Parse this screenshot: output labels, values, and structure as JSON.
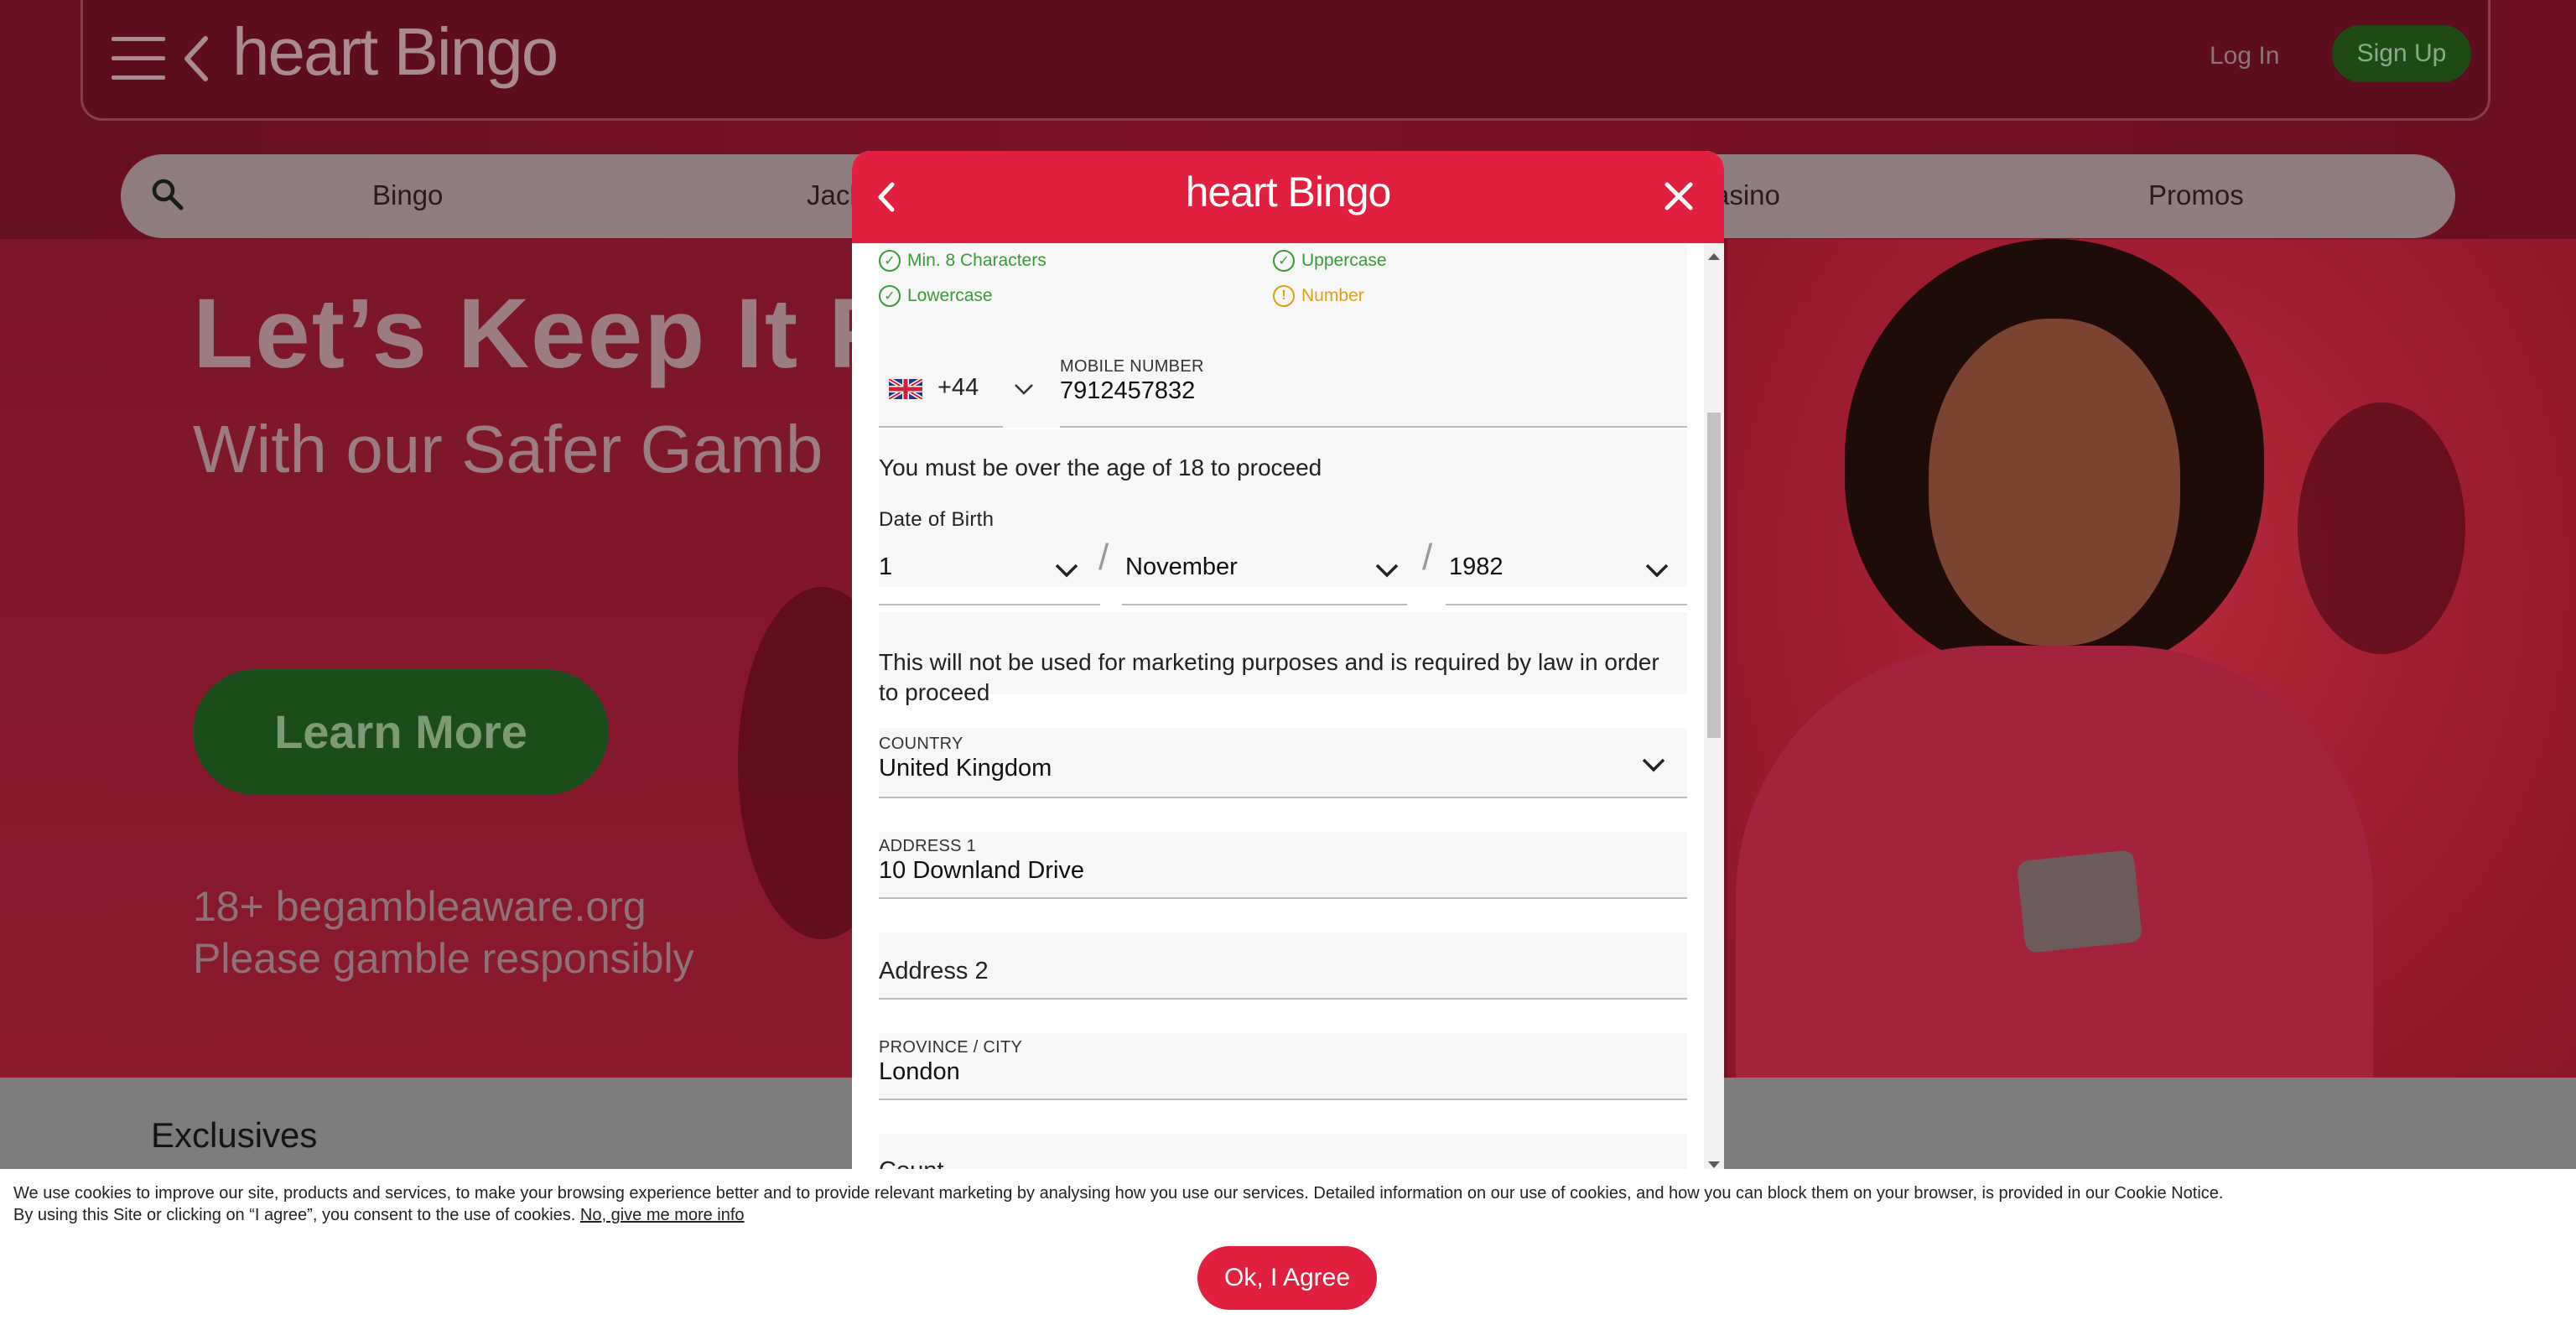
{
  "header": {
    "logo": "heart Bingo",
    "login_label": "Log In",
    "signup_label": "Sign Up"
  },
  "nav": {
    "items": [
      "Bingo",
      "Jack",
      "asino",
      "Promos"
    ]
  },
  "hero": {
    "title": "Let’s Keep It F",
    "subtitle": "With our Safer Gamb",
    "cta_label": "Learn More",
    "responsible_1": "18+ begambleaware.org",
    "responsible_2": "Please gamble responsibly"
  },
  "exclusives": {
    "title": "Exclusives"
  },
  "modal": {
    "logo": "heart Bingo",
    "password_rules": [
      {
        "label": "Min. 8 Characters",
        "status": "ok"
      },
      {
        "label": "Uppercase",
        "status": "ok"
      },
      {
        "label": "Lowercase",
        "status": "ok"
      },
      {
        "label": "Number",
        "status": "warning"
      }
    ],
    "phone": {
      "country_code": "+44",
      "label": "MOBILE NUMBER",
      "value": "7912457832"
    },
    "age_notice": "You must be over the age of 18 to proceed",
    "dob": {
      "label": "Date of Birth",
      "day": "1",
      "month": "November",
      "year": "1982",
      "separator": "/"
    },
    "dob_notice": "This will not be used for marketing purposes and is required by law in order to proceed",
    "country": {
      "label": "COUNTRY",
      "value": "United Kingdom"
    },
    "address1": {
      "label": "ADDRESS 1",
      "value": "10 Downland Drive"
    },
    "address2": {
      "placeholder": "Address 2"
    },
    "city": {
      "label": "PROVINCE / CITY",
      "value": "London"
    },
    "next_field_partial": "Count"
  },
  "cookie": {
    "line1": "We use cookies to improve our site, products and services, to make your browsing experience better and to provide relevant marketing by analysing how you use our services. Detailed information on our use of cookies, and how you can block them on your browser, is provided in our Cookie Notice.",
    "line2": "By using this Site or clicking on “I agree”, you consent to the use of cookies.",
    "more_info_link": "No, give me more info",
    "agree_label": "Ok, I Agree"
  },
  "colors": {
    "brand_red": "#e0203e",
    "ok_green": "#3a9a3a",
    "warning_orange": "#e39d19"
  }
}
